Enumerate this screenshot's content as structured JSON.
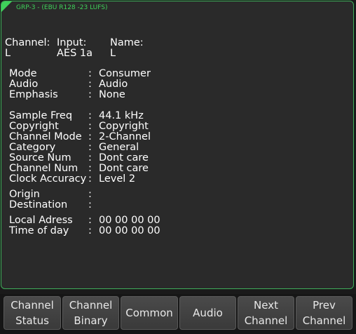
{
  "panel": {
    "title": "GRP-3 - (EBU R128 -23 LUFS)",
    "accent_color": "#3fd15a"
  },
  "channel_header": {
    "channel_label": "Channel:",
    "channel_value": "L",
    "input_label": "Input:",
    "input_value": "AES 1a",
    "name_label": "Name:",
    "name_value": "L"
  },
  "fields": [
    {
      "label": "Mode",
      "value": "Consumer"
    },
    {
      "label": "Audio",
      "value": "Audio"
    },
    {
      "label": "Emphasis",
      "value": "None"
    },
    {
      "label": "Sample Freq",
      "value": "44.1 kHz"
    },
    {
      "label": "Copyright",
      "value": "Copyright"
    },
    {
      "label": "Channel Mode",
      "value": "2-Channel"
    },
    {
      "label": "Category",
      "value": "General"
    },
    {
      "label": "Source Num",
      "value": "Dont care"
    },
    {
      "label": "Channel Num",
      "value": "Dont care"
    },
    {
      "label": "Clock Accuracy",
      "value": "Level 2"
    },
    {
      "label": "Origin",
      "value": ""
    },
    {
      "label": "Destination",
      "value": ""
    },
    {
      "label": "Local Adress",
      "value": "00 00 00 00"
    },
    {
      "label": "Time of day",
      "value": "00 00 00 00"
    }
  ],
  "buttons": [
    {
      "line1": "Channel",
      "line2": "Status"
    },
    {
      "line1": "Channel",
      "line2": "Binary"
    },
    {
      "line1": "Common",
      "line2": ""
    },
    {
      "line1": "Audio",
      "line2": ""
    },
    {
      "line1": "Next",
      "line2": "Channel"
    },
    {
      "line1": "Prev",
      "line2": "Channel"
    }
  ]
}
